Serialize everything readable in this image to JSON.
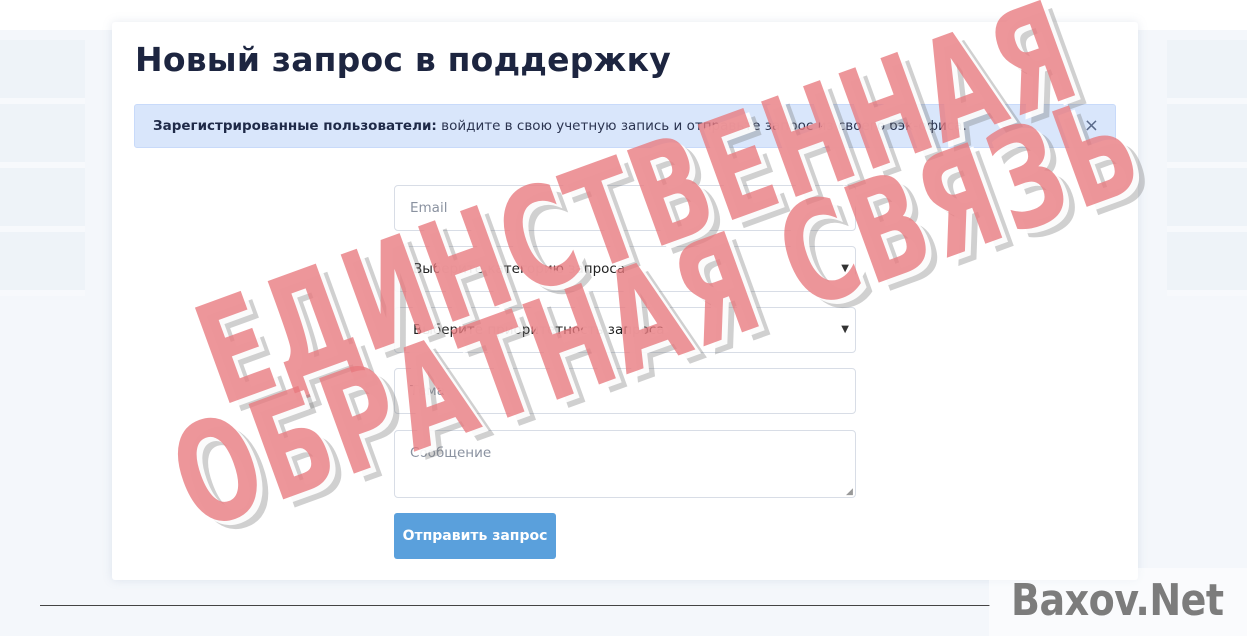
{
  "page": {
    "title": "Новый запрос в поддержку"
  },
  "alert": {
    "bold_text": "Зарегистрированные пользователи:",
    "text": " войдите в свою учетную запись и отправьте запрос из своего бэк-офиса.",
    "close_label": "×"
  },
  "form": {
    "email_placeholder": "Email",
    "category_select": "Выберите категорию запроса",
    "priority_select": "Выберите приоритетность запроса",
    "theme_placeholder": "Тема",
    "message_placeholder": "Сообщение",
    "submit_label": "Отправить запрос"
  },
  "overlay": {
    "stamp_line1": "ЕДИНСТВЕННАЯ",
    "stamp_line2": "ОБРАТНАЯ СВЯЗЬ",
    "watermark": "Baxov.Net"
  },
  "colors": {
    "accent": "#5aa0dc",
    "alert_bg": "#d9e6fb",
    "stamp": "#e8787d"
  }
}
